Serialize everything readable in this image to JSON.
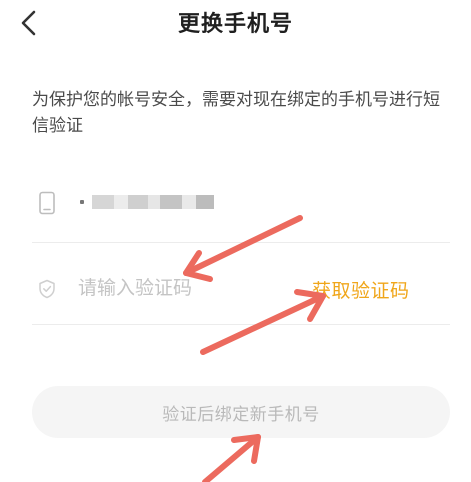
{
  "header": {
    "back_icon": "chevron-left-icon",
    "title": "更换手机号"
  },
  "description": "为保护您的帐号安全，需要对现在绑定的手机号进行短信验证",
  "phone_row": {
    "icon": "phone-icon",
    "value_obscured": true
  },
  "code_row": {
    "icon": "shield-check-icon",
    "placeholder": "请输入验证码",
    "value": "",
    "get_code_label": "获取验证码"
  },
  "submit": {
    "label": "验证后绑定新手机号",
    "enabled": false
  },
  "annotations": {
    "arrow_color": "#ec6a5e",
    "count": 3
  },
  "colors": {
    "accent": "#f0a61a",
    "disabled_button_bg": "#f5f5f5",
    "disabled_button_text": "#b9b9b9",
    "placeholder": "#c4c4c4"
  }
}
